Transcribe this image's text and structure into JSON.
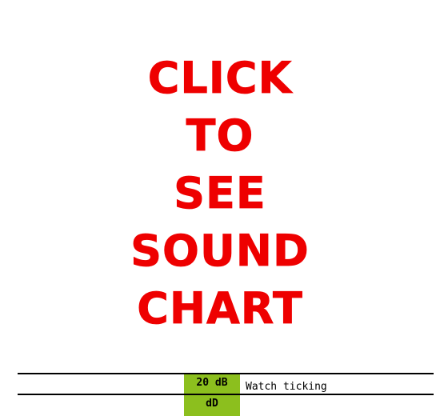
{
  "cta": {
    "lines": [
      "CLICK",
      "TO",
      "SEE",
      "SOUND",
      "CHART"
    ],
    "color": "#ee0000"
  },
  "sound_table": {
    "rows": [
      {
        "level": "20 dB",
        "description": "Watch ticking"
      }
    ],
    "footer_label": "dD levels",
    "accent_color": "#8cbf1e"
  }
}
